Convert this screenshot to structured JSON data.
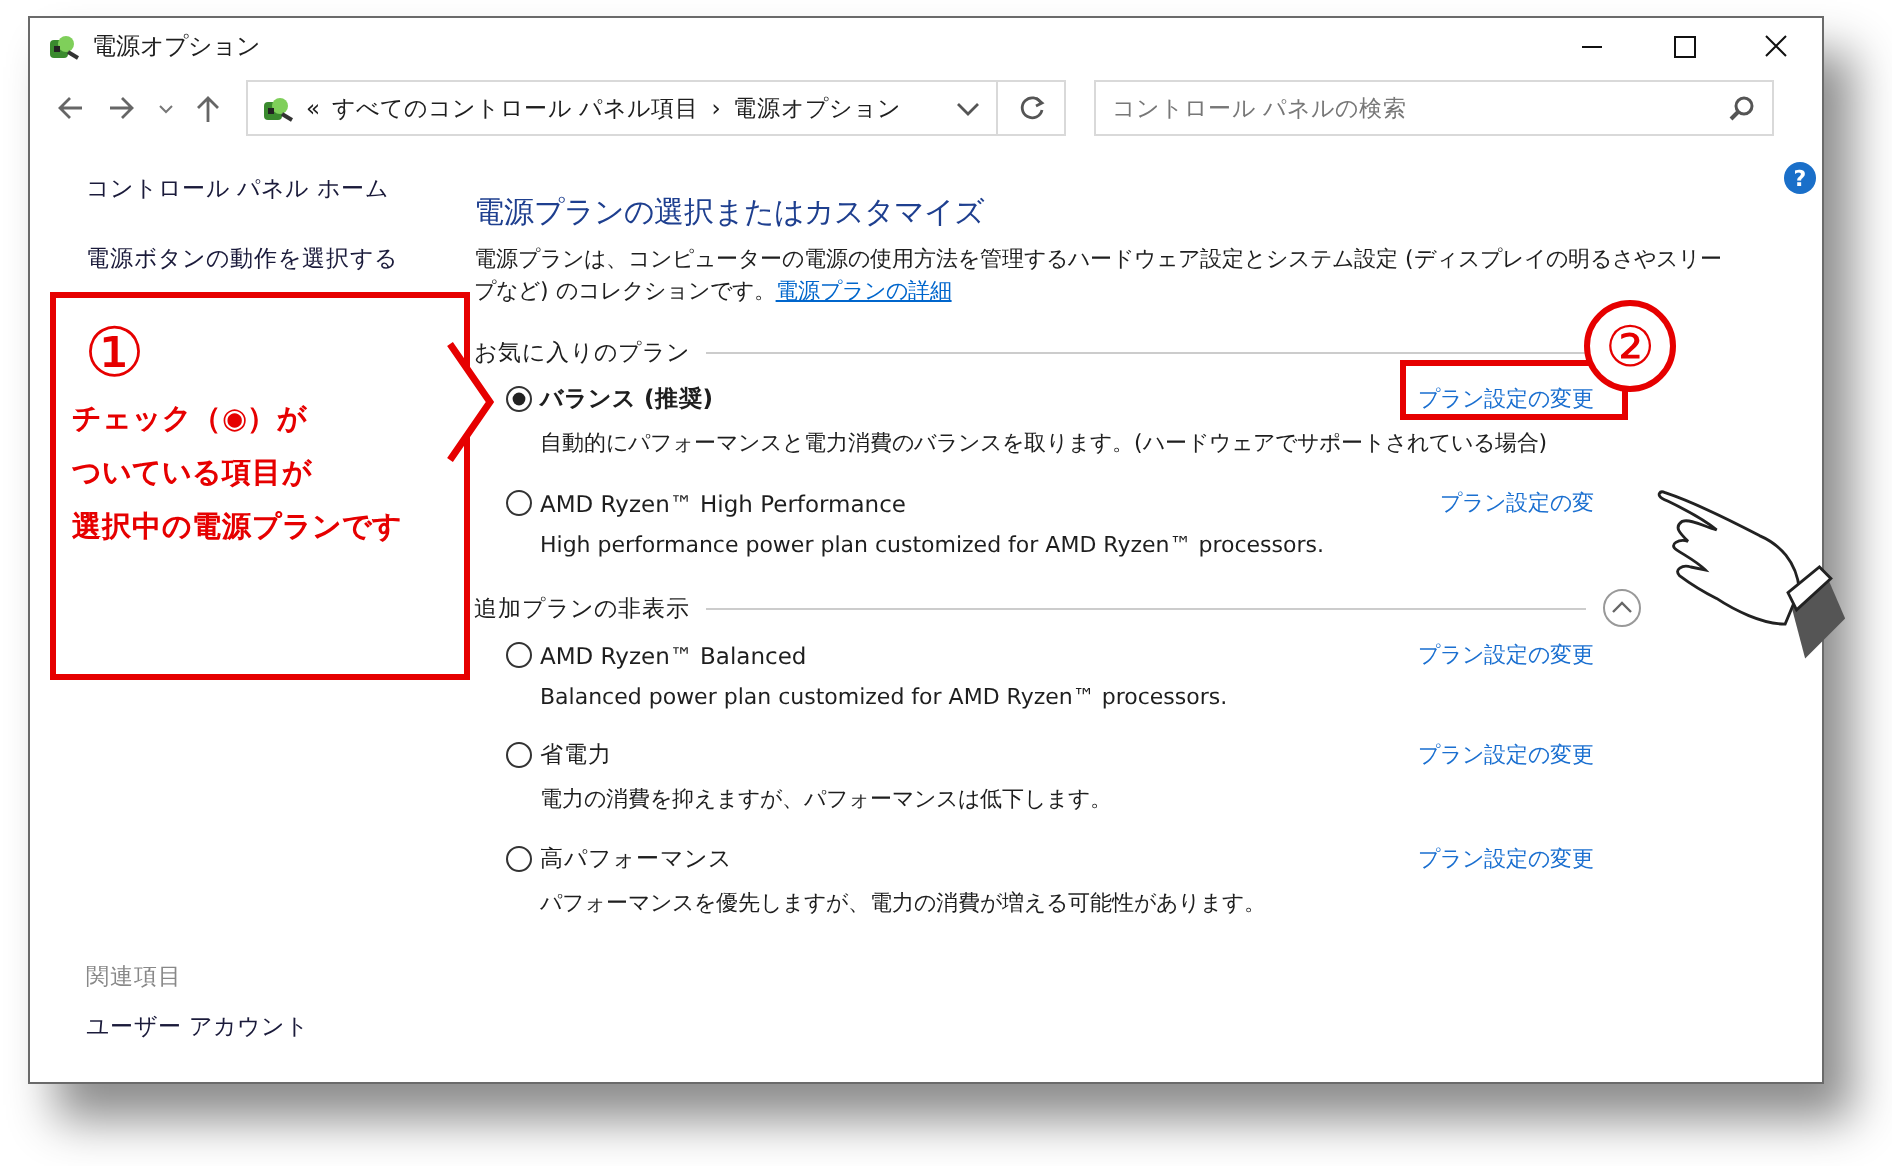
{
  "window": {
    "title": "電源オプション"
  },
  "address_bar": {
    "prefix": "«",
    "path": [
      {
        "label": "すべてのコントロール パネル項目"
      },
      {
        "label": "電源オプション"
      }
    ],
    "separator": "›"
  },
  "search": {
    "placeholder": "コントロール パネルの検索"
  },
  "help": "?",
  "sidebar": {
    "items": [
      {
        "label": "コントロール パネル ホーム"
      },
      {
        "label": "電源ボタンの動作を選択する"
      }
    ],
    "related_heading": "関連項目",
    "related": [
      {
        "label": "ユーザー アカウント"
      }
    ]
  },
  "main": {
    "title": "電源プランの選択またはカスタマイズ",
    "intro": "電源プランは、コンピューターの電源の使用方法を管理するハードウェア設定とシステム設定 (ディスプレイの明るさやスリープなど) のコレクションです。",
    "intro_link": "電源プランの詳細",
    "sections": [
      {
        "heading": "お気に入りのプラン",
        "collapse": false,
        "plans": [
          {
            "name": "バランス (推奨)",
            "description": "自動的にパフォーマンスと電力消費のバランスを取ります。(ハードウェアでサポートされている場合)",
            "link": "プラン設定の変更",
            "selected": true
          },
          {
            "name": "AMD Ryzen™ High Performance",
            "description": "High performance power plan customized for AMD Ryzen™ processors.",
            "link": "プラン設定の変",
            "selected": false
          }
        ]
      },
      {
        "heading": "追加プランの非表示",
        "collapse": true,
        "plans": [
          {
            "name": "AMD Ryzen™ Balanced",
            "description": "Balanced power plan customized for AMD Ryzen™ processors.",
            "link": "プラン設定の変更",
            "selected": false
          },
          {
            "name": "省電力",
            "description": "電力の消費を抑えますが、パフォーマンスは低下します。",
            "link": "プラン設定の変更",
            "selected": false
          },
          {
            "name": "高パフォーマンス",
            "description": "パフォーマンスを優先しますが、電力の消費が増える可能性があります。",
            "link": "プラン設定の変更",
            "selected": false
          }
        ]
      }
    ]
  },
  "annotations": [
    {
      "kind": "callout",
      "number": "①",
      "lines": [
        "チェック（◉）が",
        "ついている項目が",
        "選択中の電源プランです"
      ]
    },
    {
      "kind": "marker",
      "number": "②"
    }
  ]
}
